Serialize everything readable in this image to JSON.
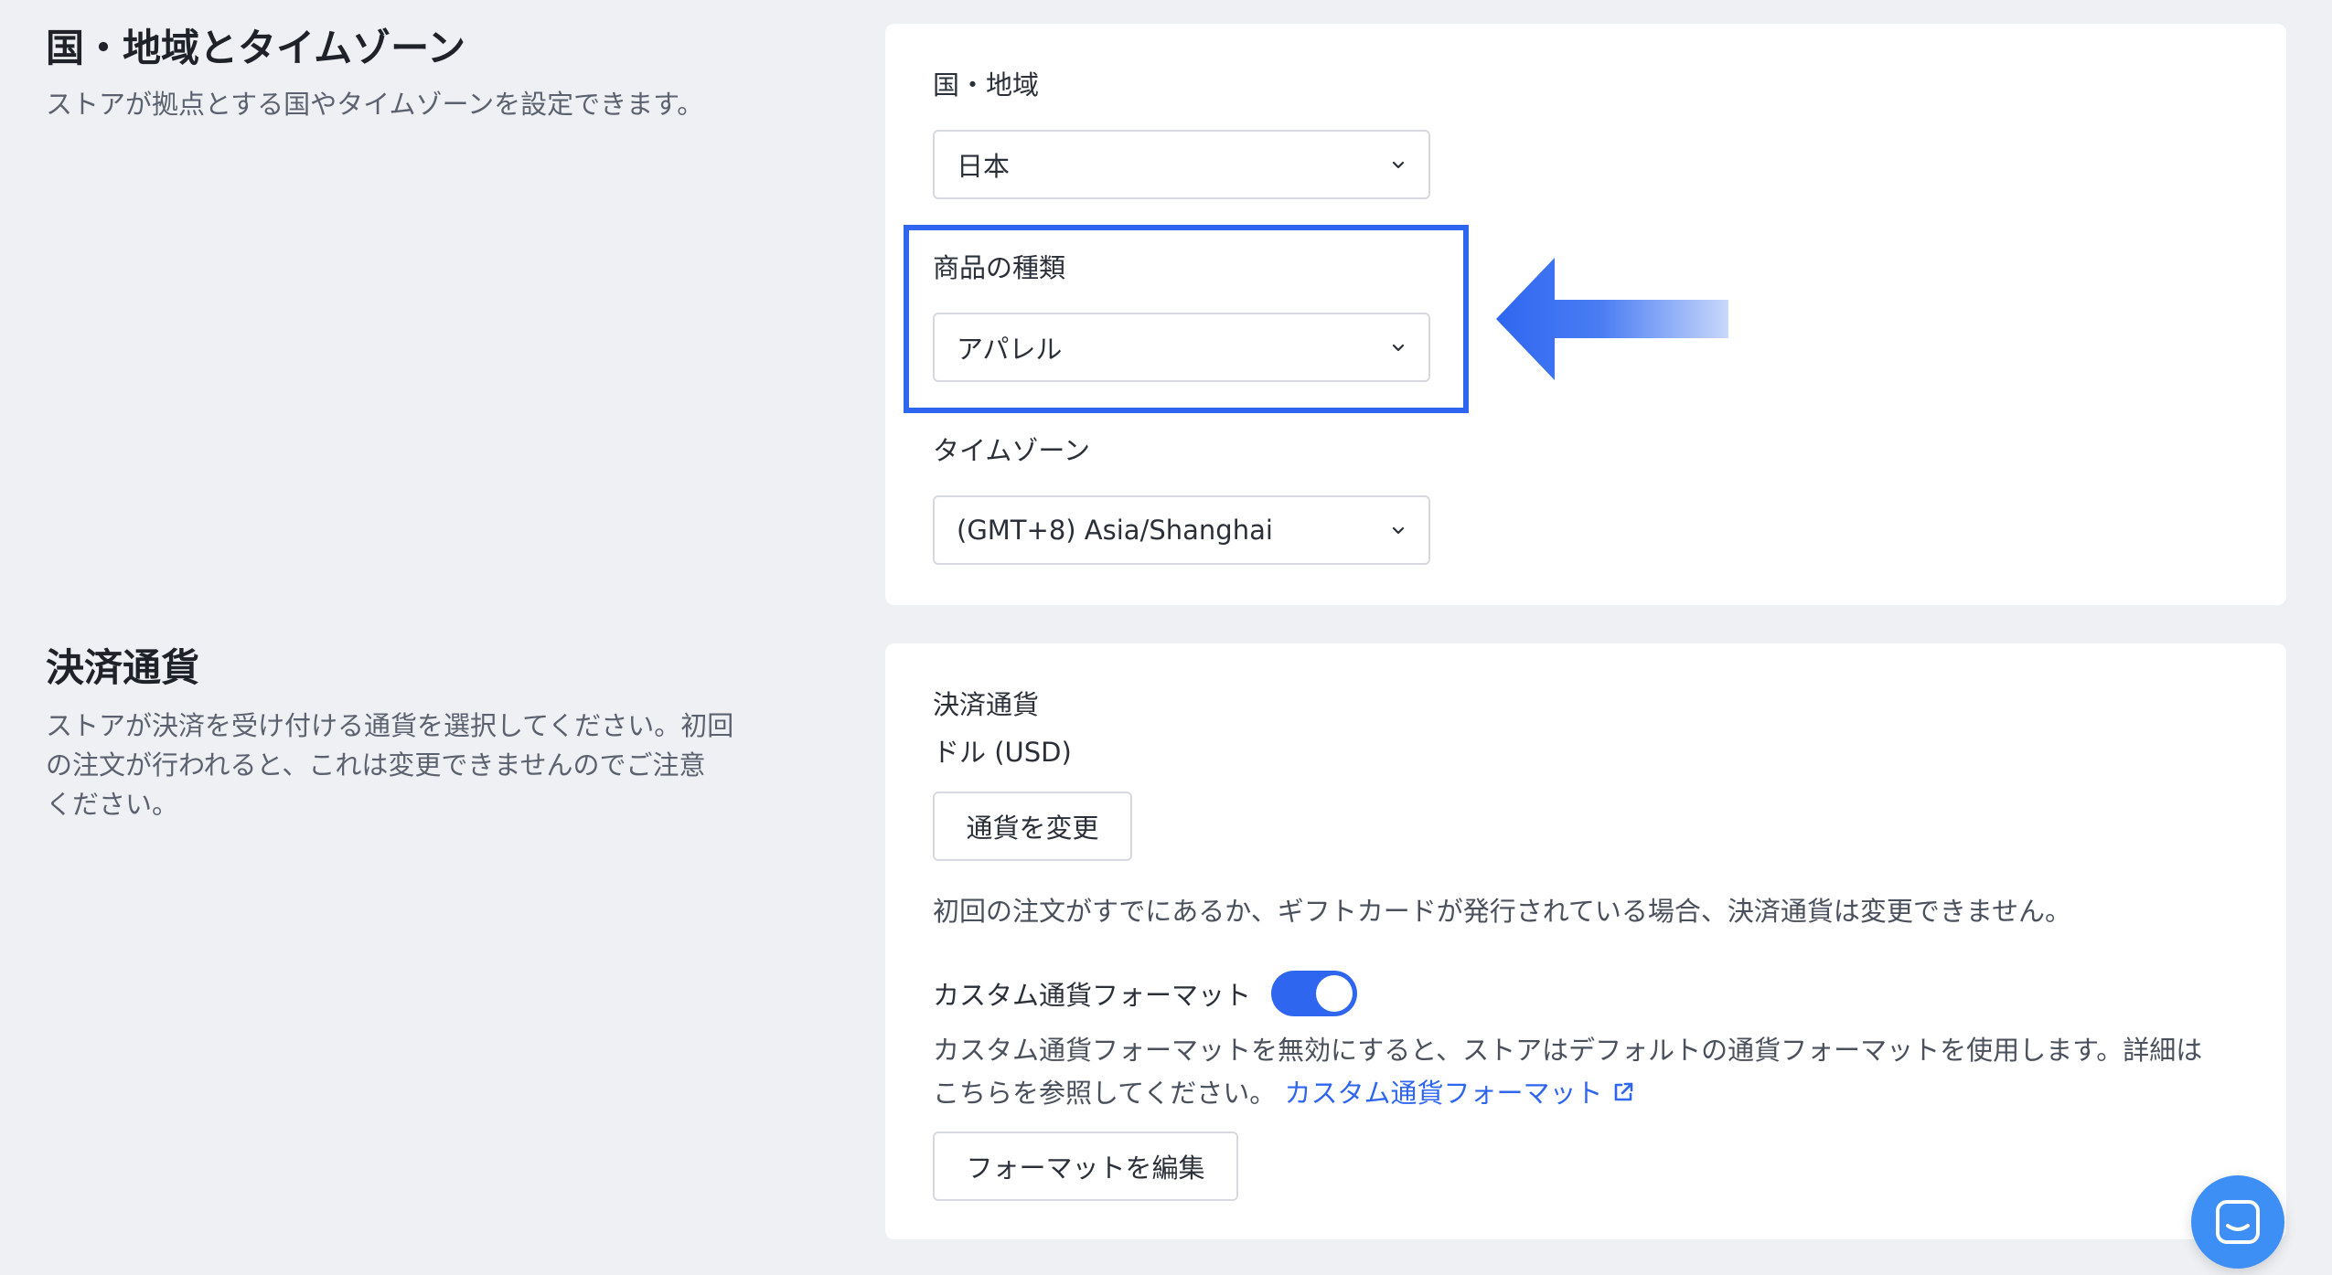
{
  "region_section": {
    "title": "国・地域とタイムゾーン",
    "description": "ストアが拠点とする国やタイムゾーンを設定できます。",
    "country_label": "国・地域",
    "country_value": "日本",
    "product_type_label": "商品の種類",
    "product_type_value": "アパレル",
    "timezone_label": "タイムゾーン",
    "timezone_value": "(GMT+8) Asia/Shanghai"
  },
  "currency_section": {
    "title": "決済通貨",
    "description_line1": "ストアが決済を受け付ける通貨を選択してください。初回",
    "description_line2": "の注文が行われると、これは変更できませんのでご注意",
    "description_line3": "ください。",
    "currency_label": "決済通貨",
    "currency_value": "ドル (USD)",
    "change_button": "通貨を変更",
    "notice": "初回の注文がすでにあるか、ギフトカードが発行されている場合、決済通貨は変更できません。",
    "custom_format_label": "カスタム通貨フォーマット",
    "custom_format_enabled": true,
    "custom_desc_line1": "カスタム通貨フォーマットを無効にすると、ストアはデフォルトの通貨フォーマットを使用します。詳細は",
    "custom_desc_line2": "こちらを参照してください。",
    "custom_format_link": "カスタム通貨フォーマット",
    "edit_format_button": "フォーマットを編集"
  },
  "colors": {
    "accent": "#2f66f0",
    "background": "#eef0f4",
    "card": "#ffffff",
    "chat_button": "#3d8ff5"
  },
  "icons": [
    "chevron-down-icon",
    "external-link-icon",
    "left-arrow-icon",
    "chat-icon"
  ]
}
